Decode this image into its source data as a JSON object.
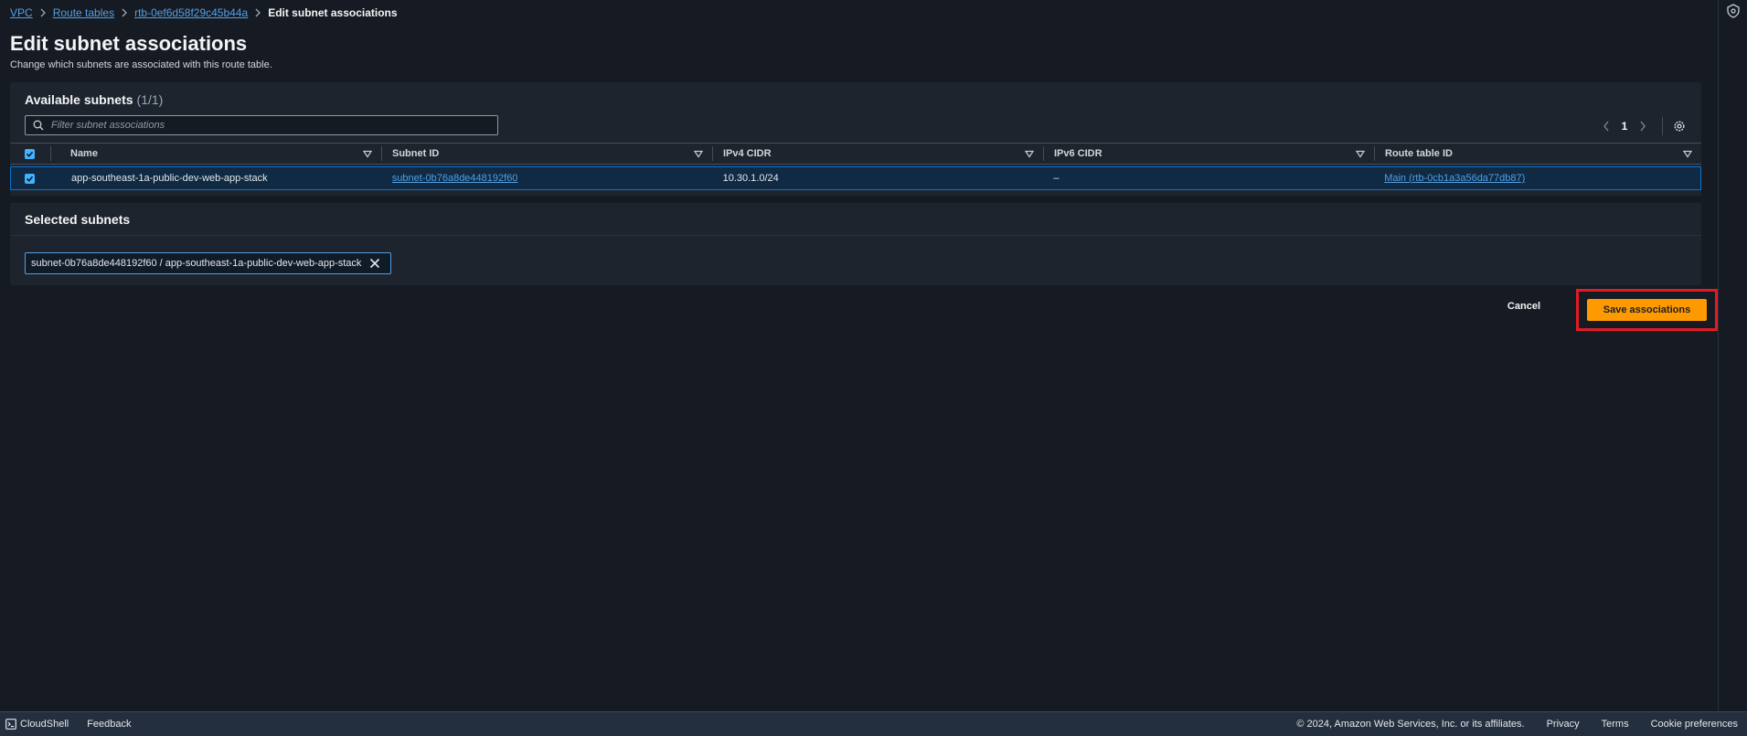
{
  "breadcrumb": {
    "items": [
      "VPC",
      "Route tables",
      "rtb-0ef6d58f29c45b44a"
    ],
    "current": "Edit subnet associations"
  },
  "page": {
    "title": "Edit subnet associations",
    "description": "Change which subnets are associated with this route table."
  },
  "available": {
    "title": "Available subnets",
    "count": "(1/1)",
    "filter_placeholder": "Filter subnet associations",
    "page_number": "1",
    "columns": [
      "Name",
      "Subnet ID",
      "IPv4 CIDR",
      "IPv6 CIDR",
      "Route table ID"
    ],
    "rows": [
      {
        "name": "app-southeast-1a-public-dev-web-app-stack",
        "subnet_id": "subnet-0b76a8de448192f60",
        "ipv4": "10.30.1.0/24",
        "ipv6": "–",
        "route_table": "Main (rtb-0cb1a3a56da77db87)"
      }
    ]
  },
  "selected": {
    "title": "Selected subnets",
    "token": "subnet-0b76a8de448192f60 / app-southeast-1a-public-dev-web-app-stack"
  },
  "actions": {
    "cancel": "Cancel",
    "save": "Save associations"
  },
  "footer": {
    "cloudshell": "CloudShell",
    "feedback": "Feedback",
    "copyright": "© 2024, Amazon Web Services, Inc. or its affiliates.",
    "privacy": "Privacy",
    "terms": "Terms",
    "cookies": "Cookie preferences"
  },
  "colors": {
    "accent": "#539fe5",
    "primary_button": "#ff9900",
    "highlight": "#e01b24",
    "checkbox": "#42b4ff"
  }
}
